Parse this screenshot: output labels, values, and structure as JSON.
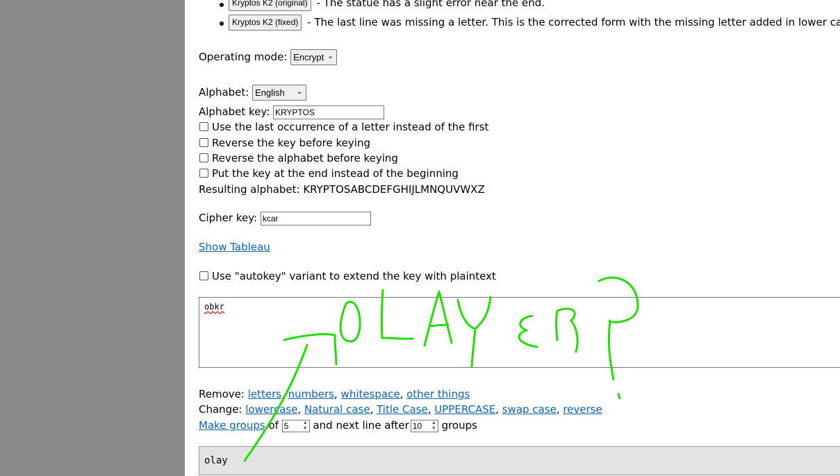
{
  "presets": [
    {
      "button": "Kryptos K2 (original)",
      "description": "- The statue has a slight error near the end."
    },
    {
      "button": "Kryptos K2 (fixed)",
      "description": "- The last line was missing a letter. This is the corrected form with the missing letter added in lower case."
    }
  ],
  "operating_mode": {
    "label": "Operating mode:",
    "value": "Encrypt"
  },
  "alphabet": {
    "label": "Alphabet:",
    "value": "English"
  },
  "alphabet_key": {
    "label": "Alphabet key:",
    "value": "KRYPTOS"
  },
  "options": [
    "Use the last occurrence of a letter instead of the first",
    "Reverse the key before keying",
    "Reverse the alphabet before keying",
    "Put the key at the end instead of the beginning"
  ],
  "resulting_alphabet": "Resulting alphabet: KRYPTOSABCDEFGHIJLMNQUVWXZ",
  "cipher_key": {
    "label": "Cipher key:",
    "value": "kcar"
  },
  "show_tableau": "Show Tableau",
  "autokey": "Use \"autokey\" variant to extend the key with plaintext",
  "input_text": "obkr",
  "remove": {
    "label": "Remove:",
    "links": [
      "letters",
      "numbers",
      "whitespace",
      "other things"
    ]
  },
  "change": {
    "label": "Change:",
    "links": [
      "lowercase",
      "Natural case",
      "Title Case",
      "UPPERCASE",
      "swap case",
      "reverse"
    ]
  },
  "groups": {
    "make_groups": "Make groups",
    "of": "of",
    "group_size": "5",
    "next_line_text": "and next line after",
    "line_groups": "10",
    "groups_word": "groups"
  },
  "output_text": "olay",
  "annotation": {
    "text": "OLAYER?",
    "color": "#22dd00"
  }
}
